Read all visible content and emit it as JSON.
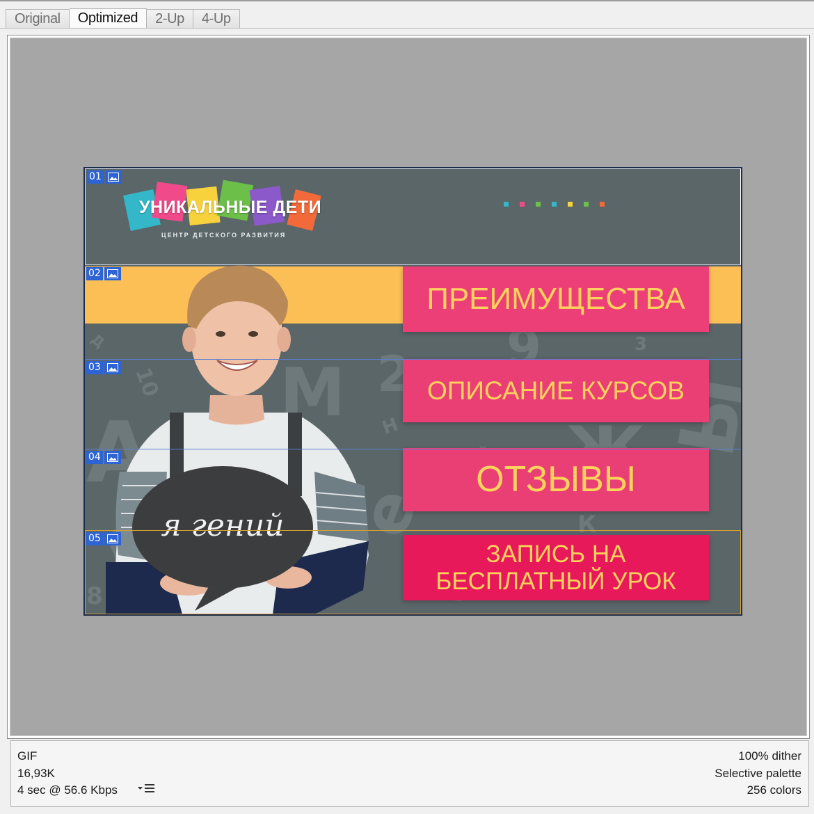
{
  "tabs": [
    {
      "label": "Original",
      "active": false
    },
    {
      "label": "Optimized",
      "active": true
    },
    {
      "label": "2-Up",
      "active": false
    },
    {
      "label": "4-Up",
      "active": false
    }
  ],
  "banner": {
    "logo": {
      "title": "УНИКАЛЬНЫЕ ДЕТИ",
      "subtitle": "ЦЕНТР ДЕТСКОГО РАЗВИТИЯ",
      "tile_colors": [
        "#34b7c8",
        "#f04a8a",
        "#f7d23c",
        "#6cc04a",
        "#8b59c9",
        "#f26a3a"
      ]
    },
    "dot_colors": [
      "#34b7c8",
      "#f04a8a",
      "#6cc04a",
      "#34b7c8",
      "#f7d23c",
      "#6cc04a",
      "#f26a3a"
    ],
    "sign_text": "я гений",
    "buttons": [
      {
        "label": "ПРЕИМУЩЕСТВА"
      },
      {
        "label": "ОПИСАНИЕ КУРСОВ"
      },
      {
        "label": "ОТЗЫВЫ"
      },
      {
        "label": "ЗАПИСЬ НА\nБЕСПЛАТНЫЙ УРОК"
      }
    ],
    "background_glyphs": [
      "А",
      "М",
      "Ж",
      "Ы",
      "б",
      "е",
      "9",
      "2",
      "4",
      "3",
      "10",
      "8",
      "К",
      "Н",
      "Й",
      "Д",
      "3"
    ]
  },
  "slices": [
    {
      "number": "01"
    },
    {
      "number": "02"
    },
    {
      "number": "03"
    },
    {
      "number": "04"
    },
    {
      "number": "05"
    }
  ],
  "info": {
    "format": "GIF",
    "size": "16,93K",
    "speed": "4 sec @ 56.6 Kbps",
    "dither": "100% dither",
    "palette": "Selective palette",
    "colors": "256 colors"
  },
  "colors": {
    "banner_bg": "#5b6669",
    "orange": "#fcbf56",
    "button_pink": "#ea3f75",
    "button_red": "#e7195b",
    "button_text": "#fcd25c",
    "slice_blue": "#2d63d2"
  }
}
